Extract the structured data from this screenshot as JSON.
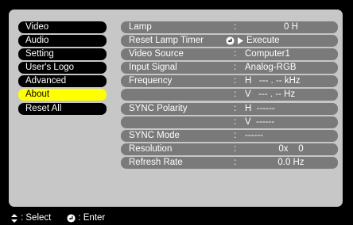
{
  "menu": {
    "items": [
      {
        "label": "Video"
      },
      {
        "label": "Audio"
      },
      {
        "label": "Setting"
      },
      {
        "label": "User's Logo"
      },
      {
        "label": "Advanced"
      },
      {
        "label": "About",
        "selected": true
      },
      {
        "label": "Reset All"
      }
    ]
  },
  "info": {
    "lamp": {
      "label": "Lamp",
      "value": "0 H"
    },
    "reset_lamp_timer": {
      "label": "Reset Lamp Timer",
      "value": "Execute"
    },
    "video_source": {
      "label": "Video Source",
      "value": "Computer1"
    },
    "input_signal": {
      "label": "Input Signal",
      "value": "Analog-RGB"
    },
    "frequency_h": {
      "label": "Frequency",
      "value": "H   --- . -- kHz"
    },
    "frequency_v": {
      "value": "V   --- . -- Hz"
    },
    "sync_polarity_h": {
      "label": "SYNC Polarity",
      "value": "H  ------"
    },
    "sync_polarity_v": {
      "value": "V  ------"
    },
    "sync_mode": {
      "label": "SYNC Mode",
      "value": "------"
    },
    "resolution": {
      "label": "Resolution",
      "value": "0x    0"
    },
    "refresh_rate": {
      "label": "Refresh Rate",
      "value": "0.0 Hz"
    }
  },
  "colon": ":",
  "footer": {
    "select_label": ": Select",
    "enter_label": ": Enter"
  },
  "icons": {
    "select": "up-down-arrows-icon",
    "enter": "enter-icon",
    "execute_arrow": "right-arrow-icon"
  },
  "colors": {
    "panel": "#c7c7c7",
    "menu_item": "#000000",
    "menu_selected": "#ffff00",
    "row": "#7a7a7a"
  }
}
